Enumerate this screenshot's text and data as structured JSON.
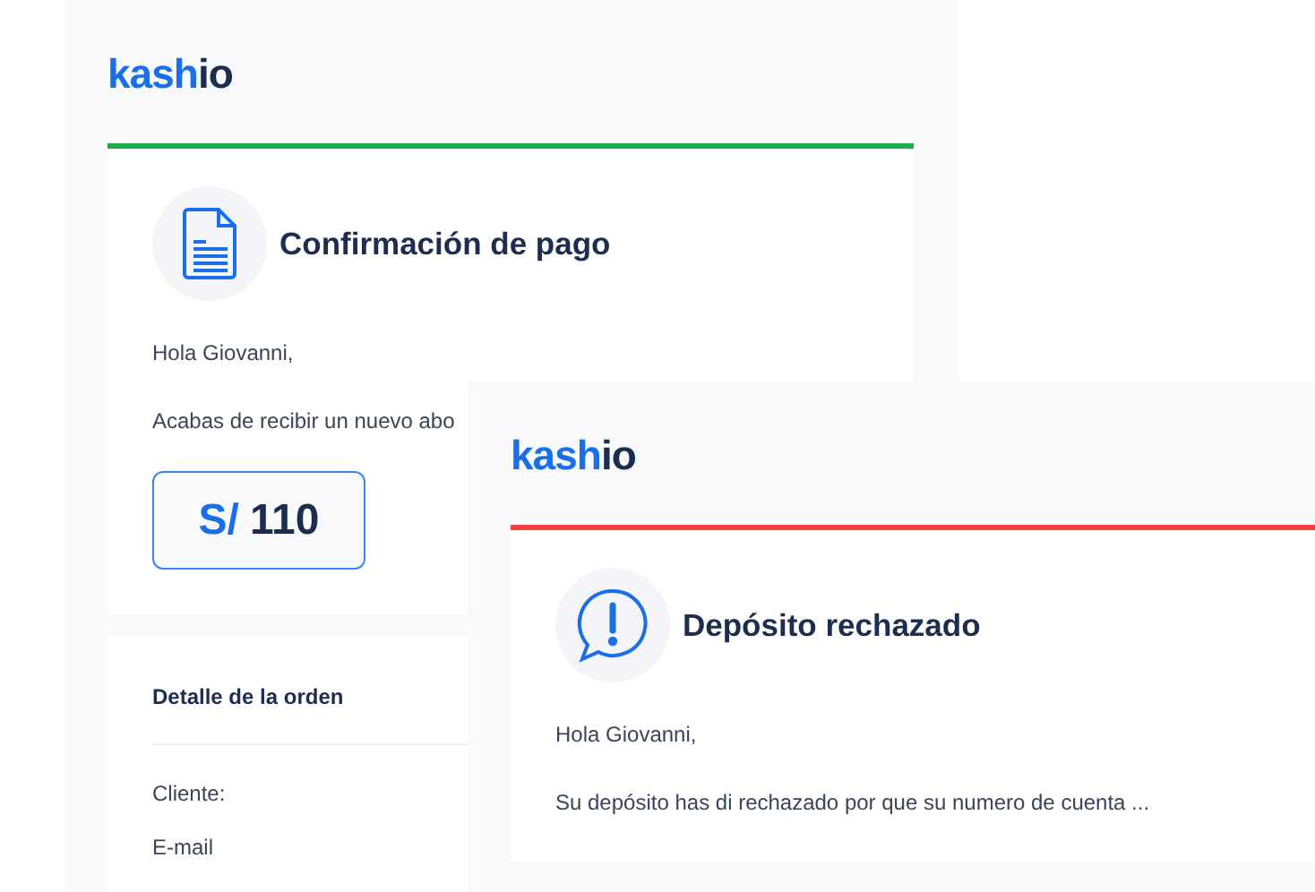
{
  "emails": [
    {
      "logo": {
        "brand": "kash",
        "suffix": "io"
      },
      "color": "#1fad4e",
      "kind": "document",
      "title": "Confirmación de pago",
      "greeting": "Hola Giovanni,",
      "message": "Acabas de recibir un nuevo abo",
      "amount": {
        "currency": "S/",
        "value": "110"
      },
      "details": {
        "heading": "Detalle de la orden",
        "fields": [
          "Cliente:",
          "E-mail"
        ]
      }
    },
    {
      "logo": {
        "brand": "kash",
        "suffix": "io"
      },
      "color": "#f0433f",
      "kind": "alert",
      "title": "Depósito rechazado",
      "greeting": "Hola Giovanni,",
      "message": "Su depósito has di rechazado por que su numero de cuenta ..."
    }
  ]
}
